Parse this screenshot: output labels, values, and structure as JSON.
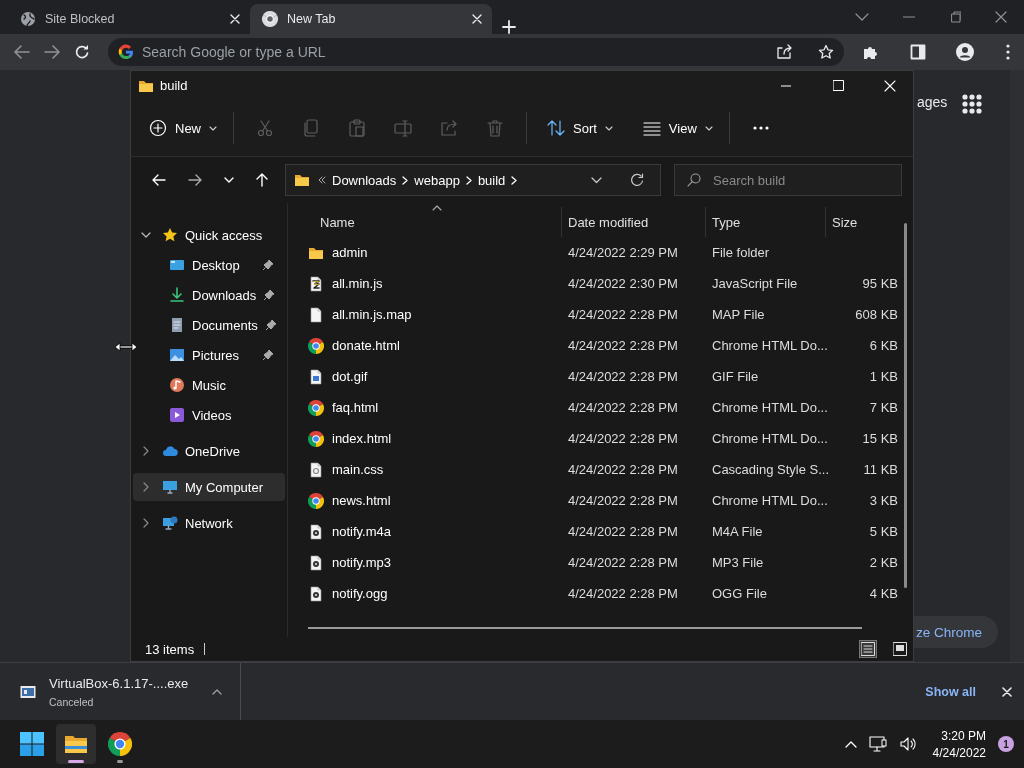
{
  "browser": {
    "tabs": [
      {
        "title": "Site Blocked",
        "kind": "site",
        "selected": false
      },
      {
        "title": "New Tab",
        "kind": "newtab",
        "selected": true
      }
    ],
    "omnibox": {
      "placeholder": "Search Google or type a URL"
    },
    "page": {
      "header_link": "ages",
      "corner_button": "ze Chrome"
    }
  },
  "explorer": {
    "title": "build",
    "toolbar": [
      {
        "kind": "new",
        "label": "New",
        "disabled": false
      },
      {
        "kind": "cut",
        "disabled": true
      },
      {
        "kind": "copy",
        "disabled": true
      },
      {
        "kind": "paste",
        "disabled": true
      },
      {
        "kind": "rename",
        "disabled": true
      },
      {
        "kind": "share",
        "disabled": true
      },
      {
        "kind": "delete",
        "disabled": true
      },
      {
        "kind": "sort",
        "label": "Sort",
        "disabled": false
      },
      {
        "kind": "view",
        "label": "View",
        "disabled": false
      },
      {
        "kind": "more",
        "disabled": false
      }
    ],
    "address": {
      "crumbs": [
        "Downloads",
        "webapp",
        "build"
      ]
    },
    "search": {
      "placeholder": "Search build"
    },
    "sidebar": [
      {
        "label": "Quick access",
        "kind": "star",
        "expanded": true,
        "selected": false,
        "children": [
          {
            "label": "Desktop",
            "kind": "desktop",
            "pinned": true,
            "selected": false
          },
          {
            "label": "Downloads",
            "kind": "downloads",
            "pinned": true,
            "selected": false
          },
          {
            "label": "Documents",
            "kind": "documents",
            "pinned": true,
            "selected": false
          },
          {
            "label": "Pictures",
            "kind": "pictures",
            "pinned": true,
            "selected": false
          },
          {
            "label": "Music",
            "kind": "music",
            "pinned": false,
            "selected": false
          },
          {
            "label": "Videos",
            "kind": "videos",
            "pinned": false,
            "selected": false
          }
        ]
      },
      {
        "label": "OneDrive",
        "kind": "cloud",
        "expanded": false,
        "selected": false
      },
      {
        "label": "My Computer",
        "kind": "computer",
        "expanded": false,
        "selected": true
      },
      {
        "label": "Network",
        "kind": "network",
        "expanded": false,
        "selected": false
      }
    ],
    "columns": [
      {
        "label": "Name",
        "sorted": true
      },
      {
        "label": "Date modified",
        "sorted": false
      },
      {
        "label": "Type",
        "sorted": false
      },
      {
        "label": "Size",
        "sorted": false
      }
    ],
    "rows": [
      {
        "name": "admin",
        "date": "4/24/2022 2:29 PM",
        "type": "File folder",
        "kind": "folder"
      },
      {
        "name": "all.min.js",
        "date": "4/24/2022 2:30 PM",
        "type": "JavaScript File",
        "size": "95 KB",
        "kind": "script"
      },
      {
        "name": "all.min.js.map",
        "date": "4/24/2022 2:28 PM",
        "type": "MAP File",
        "size": "608 KB",
        "kind": "blank"
      },
      {
        "name": "donate.html",
        "date": "4/24/2022 2:28 PM",
        "type": "Chrome HTML Do...",
        "size": "6 KB",
        "kind": "chrome"
      },
      {
        "name": "dot.gif",
        "date": "4/24/2022 2:28 PM",
        "type": "GIF File",
        "size": "1 KB",
        "kind": "image"
      },
      {
        "name": "faq.html",
        "date": "4/24/2022 2:28 PM",
        "type": "Chrome HTML Do...",
        "size": "7 KB",
        "kind": "chrome"
      },
      {
        "name": "index.html",
        "date": "4/24/2022 2:28 PM",
        "type": "Chrome HTML Do...",
        "size": "15 KB",
        "kind": "chrome"
      },
      {
        "name": "main.css",
        "date": "4/24/2022 2:28 PM",
        "type": "Cascading Style S...",
        "size": "11 KB",
        "kind": "css"
      },
      {
        "name": "news.html",
        "date": "4/24/2022 2:28 PM",
        "type": "Chrome HTML Do...",
        "size": "3 KB",
        "kind": "chrome"
      },
      {
        "name": "notify.m4a",
        "date": "4/24/2022 2:28 PM",
        "type": "M4A File",
        "size": "5 KB",
        "kind": "audio"
      },
      {
        "name": "notify.mp3",
        "date": "4/24/2022 2:28 PM",
        "type": "MP3 File",
        "size": "2 KB",
        "kind": "audio"
      },
      {
        "name": "notify.ogg",
        "date": "4/24/2022 2:28 PM",
        "type": "OGG File",
        "size": "4 KB",
        "kind": "audio"
      }
    ],
    "status": "13 items",
    "view_buttons": [
      {
        "kind": "details",
        "selected": true
      },
      {
        "kind": "thumbnails",
        "selected": false
      }
    ]
  },
  "downloads": {
    "file": "VirtualBox-6.1.17-....exe",
    "status": "Canceled",
    "show_all": "Show all"
  },
  "taskbar": {
    "apps": [
      {
        "kind": "start",
        "selected": false,
        "running": false
      },
      {
        "kind": "explorer",
        "selected": true,
        "running": true
      },
      {
        "kind": "chrome",
        "selected": false,
        "running": true
      }
    ],
    "time": "3:20 PM",
    "date": "4/24/2022",
    "notifications": "1"
  }
}
